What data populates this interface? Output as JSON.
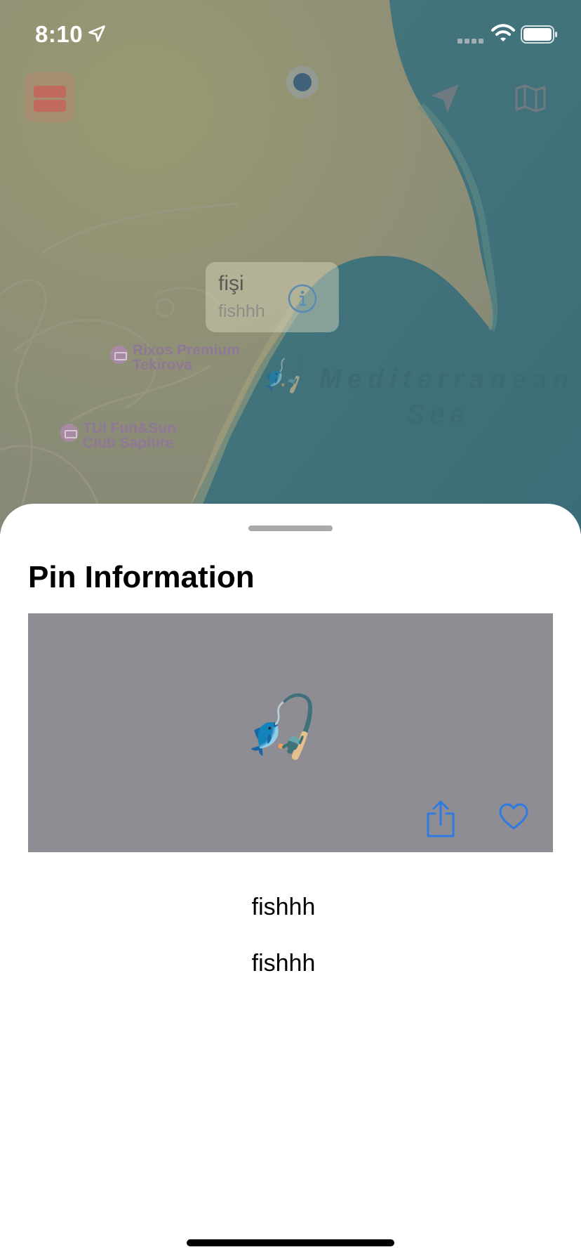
{
  "status_bar": {
    "time": "8:10",
    "location_icon": "location-arrow-icon",
    "signal_icon": "cellular-signal-icon",
    "wifi_icon": "wifi-icon",
    "battery_icon": "battery-full-icon"
  },
  "map": {
    "controls": [
      {
        "name": "layers",
        "icon": "layers-icon"
      },
      {
        "name": "locate",
        "icon": "location-arrow-icon"
      },
      {
        "name": "map-type",
        "icon": "map-icon"
      }
    ],
    "callout": {
      "title": "fişi",
      "subtitle": "fishhh",
      "info_icon": "info-circle-icon"
    },
    "pois": [
      {
        "label_line1": "Rixos Premium",
        "label_line2": "Tekirova",
        "icon": "hotel-bed-icon"
      },
      {
        "label_line1": "TUI Fun&Sun",
        "label_line2": "Club Saphire",
        "icon": "hotel-bed-icon"
      }
    ],
    "sea_label_line1": "Mediterranean",
    "sea_label_line2": "Sea",
    "pin_emoji": "🎣",
    "colors": {
      "land": "#8d8e78",
      "sea": "#3f7b86",
      "user_dot": "#41617b"
    }
  },
  "sheet": {
    "title": "Pin Information",
    "photo_emoji": "🎣",
    "photo_background": "#8e8d93",
    "share_icon": "share-icon",
    "favorite_icon": "heart-icon",
    "accent": "#2f7be4",
    "details": [
      "fishhh",
      "fishhh"
    ]
  }
}
